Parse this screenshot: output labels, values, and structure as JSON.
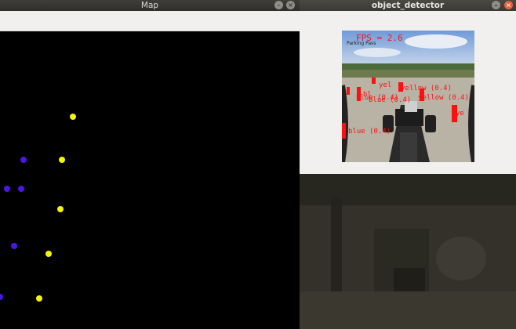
{
  "map_window": {
    "title": "Map",
    "cones": [
      {
        "color": "yellow",
        "label": "yellow-cone"
      },
      {
        "color": "blue",
        "label": "blue-cone"
      },
      {
        "color": "yellow",
        "label": "yellow-cone"
      },
      {
        "color": "blue",
        "label": "blue-cone"
      },
      {
        "color": "blue",
        "label": "blue-cone"
      },
      {
        "color": "yellow",
        "label": "yellow-cone"
      },
      {
        "color": "blue",
        "label": "blue-cone"
      },
      {
        "color": "yellow",
        "label": "yellow-cone"
      },
      {
        "color": "blue",
        "label": "blue-cone"
      },
      {
        "color": "yellow",
        "label": "yellow-cone"
      }
    ]
  },
  "detector_window": {
    "title": "object_detector",
    "fps_text": "FPS = 2.6",
    "stamp_text": "Parking Pass",
    "labels": [
      {
        "text": "yel"
      },
      {
        "text": "bl"
      },
      {
        "text": "yellow (0.4)"
      },
      {
        "text": "blue (0.4)"
      },
      {
        "text": "yellow (0.4)"
      },
      {
        "text": "blue (0.4)"
      },
      {
        "text": "ye"
      },
      {
        "text": "blue (0.4)"
      }
    ]
  },
  "colors": {
    "yellow_cone": "#f5f508",
    "blue_cone": "#4a16e8",
    "detection_red": "#ff1010",
    "titlebar": "#3c3b37",
    "window_bg": "#f1f0ee"
  },
  "icons": [
    "minimize-icon",
    "close-icon"
  ]
}
